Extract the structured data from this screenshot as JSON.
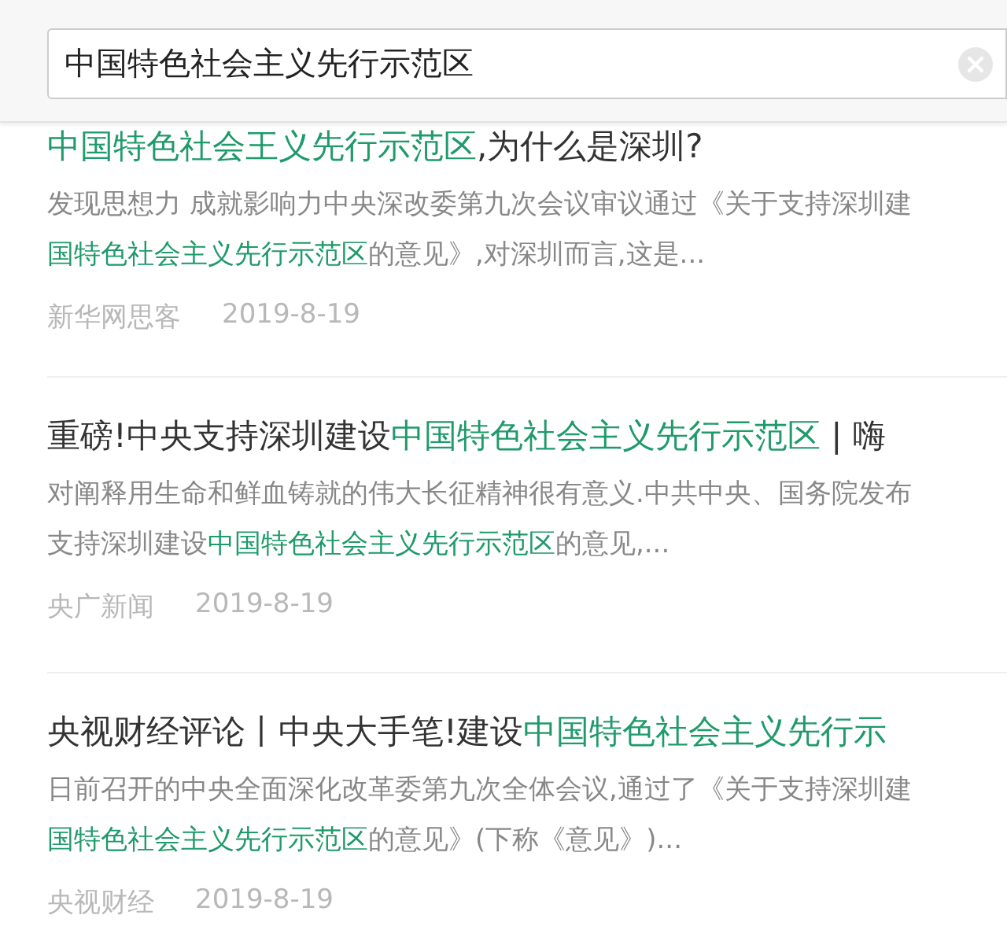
{
  "search": {
    "value": "中国特色社会主义先行示范区"
  },
  "results": [
    {
      "title": [
        {
          "text": "中国特色社会王义先行示范区",
          "highlight": true
        },
        {
          "text": ",为什么是深圳?",
          "highlight": false
        }
      ],
      "snippet_lines": [
        [
          {
            "text": "发现思想力 成就影响力中央深改委第九次会议审议通过《关于支持深圳建",
            "highlight": false
          }
        ],
        [
          {
            "text": "国特色社会主义先行示范区",
            "highlight": true
          },
          {
            "text": "的意见》,对深圳而言,这是...",
            "highlight": false
          }
        ]
      ],
      "source": "新华网思客",
      "date": "2019-8-19"
    },
    {
      "title": [
        {
          "text": "重磅!中央支持深圳建设",
          "highlight": false
        },
        {
          "text": "中国特色社会主义先行示范区",
          "highlight": true
        },
        {
          "text": " | 嗨",
          "highlight": false
        }
      ],
      "snippet_lines": [
        [
          {
            "text": "对阐释用生命和鲜血铸就的伟大长征精神很有意义.中共中央、国务院发布",
            "highlight": false
          }
        ],
        [
          {
            "text": "支持深圳建设",
            "highlight": false
          },
          {
            "text": "中国特色社会主义先行示范区",
            "highlight": true
          },
          {
            "text": "的意见,...",
            "highlight": false
          }
        ]
      ],
      "source": "央广新闻",
      "date": "2019-8-19"
    },
    {
      "title": [
        {
          "text": "央视财经评论丨中央大手笔!建设",
          "highlight": false
        },
        {
          "text": "中国特色社会主义先行示",
          "highlight": true
        }
      ],
      "snippet_lines": [
        [
          {
            "text": "日前召开的中央全面深化改革委第九次全体会议,通过了《关于支持深圳建",
            "highlight": false
          }
        ],
        [
          {
            "text": "国特色社会主义先行示范区",
            "highlight": true
          },
          {
            "text": "的意见》(下称《意见》)...",
            "highlight": false
          }
        ]
      ],
      "source": "央视财经",
      "date": "2019-8-19"
    }
  ]
}
